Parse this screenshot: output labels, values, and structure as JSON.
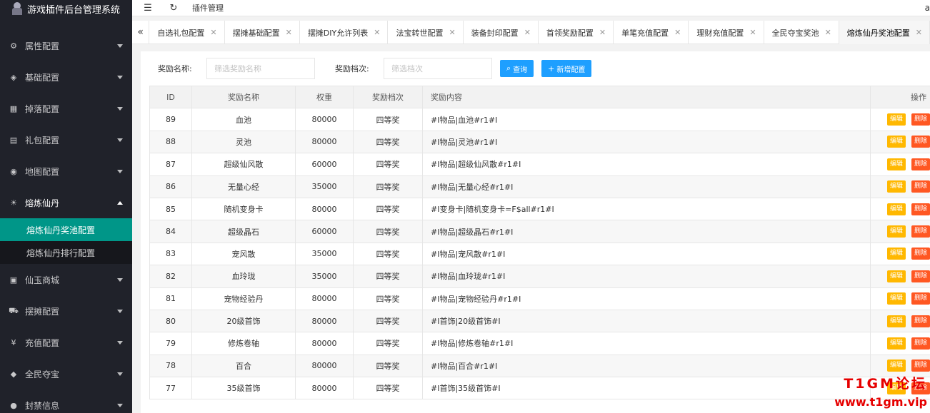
{
  "app": {
    "title": "游戏插件后台管理系统"
  },
  "header": {
    "breadcrumb": "插件管理",
    "user": "a"
  },
  "sidebar": {
    "items": [
      {
        "label": "属性配置",
        "icon": "gear-icon"
      },
      {
        "label": "基础配置",
        "icon": "layers-icon"
      },
      {
        "label": "掉落配置",
        "icon": "gift-icon"
      },
      {
        "label": "礼包配置",
        "icon": "clipboard-icon"
      },
      {
        "label": "地图配置",
        "icon": "location-icon"
      },
      {
        "label": "熔炼仙丹",
        "icon": "fire-icon"
      }
    ],
    "sub_items": [
      {
        "label": "熔炼仙丹奖池配置"
      },
      {
        "label": "熔炼仙丹排行配置"
      }
    ],
    "items_after": [
      {
        "label": "仙玉商城",
        "icon": "apps-icon"
      },
      {
        "label": "摆摊配置",
        "icon": "cart-icon"
      },
      {
        "label": "充值配置",
        "icon": "yen-icon"
      },
      {
        "label": "全民夺宝",
        "icon": "diamond-icon"
      },
      {
        "label": "封禁信息",
        "icon": "user-icon"
      }
    ]
  },
  "tabs": [
    {
      "label": "自选礼包配置"
    },
    {
      "label": "摆摊基础配置"
    },
    {
      "label": "摆摊DIY允许列表"
    },
    {
      "label": "法宝转世配置"
    },
    {
      "label": "装备封印配置"
    },
    {
      "label": "首领奖励配置"
    },
    {
      "label": "单笔充值配置"
    },
    {
      "label": "理财充值配置"
    },
    {
      "label": "全民夺宝奖池"
    },
    {
      "label": "熔炼仙丹奖池配置"
    }
  ],
  "search": {
    "name_label": "奖励名称:",
    "name_placeholder": "筛选奖励名称",
    "tier_label": "奖励档次:",
    "tier_placeholder": "筛选档次",
    "query_label": "查询",
    "add_label": "新增配置"
  },
  "table": {
    "headers": [
      "ID",
      "奖励名称",
      "权重",
      "奖励档次",
      "奖励内容",
      "操作"
    ],
    "edit_label": "编辑",
    "delete_label": "删除",
    "rows": [
      {
        "id": "89",
        "name": "血池",
        "weight": "80000",
        "tier": "四等奖",
        "content": "#I物品|血池#r1#I"
      },
      {
        "id": "88",
        "name": "灵池",
        "weight": "80000",
        "tier": "四等奖",
        "content": "#I物品|灵池#r1#I"
      },
      {
        "id": "87",
        "name": "超级仙风散",
        "weight": "60000",
        "tier": "四等奖",
        "content": "#I物品|超级仙风散#r1#I"
      },
      {
        "id": "86",
        "name": "无量心经",
        "weight": "35000",
        "tier": "四等奖",
        "content": "#I物品|无量心经#r1#I"
      },
      {
        "id": "85",
        "name": "随机变身卡",
        "weight": "80000",
        "tier": "四等奖",
        "content": "#I变身卡|随机变身卡=F$all#r1#I"
      },
      {
        "id": "84",
        "name": "超级晶石",
        "weight": "60000",
        "tier": "四等奖",
        "content": "#I物品|超级晶石#r1#I"
      },
      {
        "id": "83",
        "name": "宠风散",
        "weight": "35000",
        "tier": "四等奖",
        "content": "#I物品|宠风散#r1#I"
      },
      {
        "id": "82",
        "name": "血玲珑",
        "weight": "35000",
        "tier": "四等奖",
        "content": "#I物品|血玲珑#r1#I"
      },
      {
        "id": "81",
        "name": "宠物经验丹",
        "weight": "80000",
        "tier": "四等奖",
        "content": "#I物品|宠物经验丹#r1#I"
      },
      {
        "id": "80",
        "name": "20级首饰",
        "weight": "80000",
        "tier": "四等奖",
        "content": "#I首饰|20级首饰#I"
      },
      {
        "id": "79",
        "name": "修炼卷轴",
        "weight": "80000",
        "tier": "四等奖",
        "content": "#I物品|修炼卷轴#r1#I"
      },
      {
        "id": "78",
        "name": "百合",
        "weight": "80000",
        "tier": "四等奖",
        "content": "#I物品|百合#r1#I"
      },
      {
        "id": "77",
        "name": "35级首饰",
        "weight": "80000",
        "tier": "四等奖",
        "content": "#I首饰|35级首饰#I"
      }
    ]
  },
  "watermark": {
    "line1": "T1GM论坛",
    "line2": "www.t1gm.vip"
  },
  "colors": {
    "sidebar_bg": "#20222a",
    "active_menu": "#009688",
    "primary_button": "#1e9fff",
    "edit_tag": "#ffb800",
    "delete_tag": "#ff5722",
    "watermark": "#e60000"
  }
}
